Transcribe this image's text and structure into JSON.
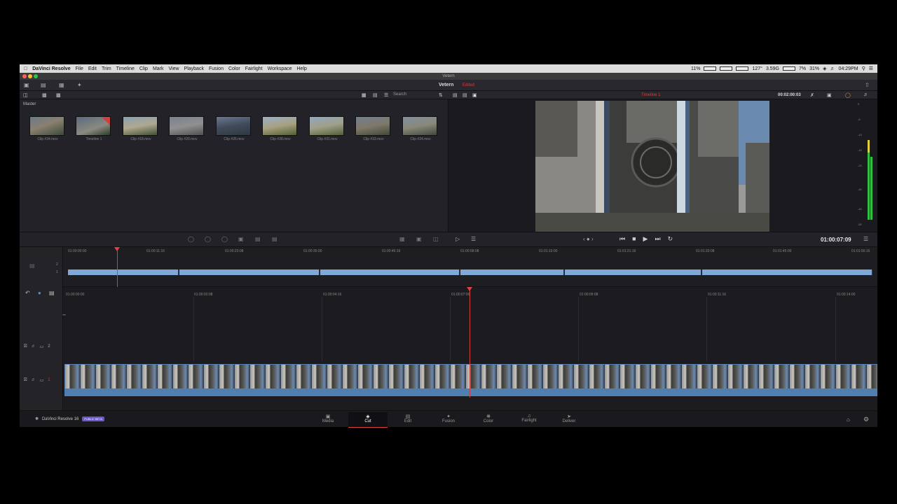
{
  "menubar": {
    "app": "DaVinci Resolve",
    "items": [
      "File",
      "Edit",
      "Trim",
      "Timeline",
      "Clip",
      "Mark",
      "View",
      "Playback",
      "Fusion",
      "Color",
      "Fairlight",
      "Workspace",
      "Help"
    ],
    "status": {
      "cpu": "11%",
      "temp": "127°",
      "mem": "3.59G",
      "net": "7%",
      "battery": "31%",
      "time": "04:29PM"
    }
  },
  "window": {
    "title": "Vetern"
  },
  "topbar": {
    "project_name": "Vetern",
    "project_status": "Edited"
  },
  "mediapool": {
    "search_label": "Search",
    "bin_label": "Master",
    "clips": [
      {
        "name": "Clip #34.mov"
      },
      {
        "name": "Timeline 1"
      },
      {
        "name": "Clip #18.mov"
      },
      {
        "name": "Clip #20.mov"
      },
      {
        "name": "Clip #26.mov"
      },
      {
        "name": "Clip #28.mov"
      },
      {
        "name": "Clip #31.mov"
      },
      {
        "name": "Clip #33.mov"
      },
      {
        "name": "Clip #24.mov"
      }
    ]
  },
  "viewer": {
    "timeline_name": "Timeline 1",
    "duration": "00:02:00:03",
    "timecode": "01:00:07:09",
    "meter_labels": [
      "0",
      "-5",
      "-10",
      "-15",
      "-20",
      "-30",
      "-40",
      "-50"
    ]
  },
  "overview_ruler": [
    "01:00:00:00",
    "01:00:11:16",
    "01:00:23:08",
    "01:00:35:00",
    "01:00:46:16",
    "01:00:58:08",
    "01:01:10:00",
    "01:01:21:16",
    "01:01:33:08",
    "01:01:45:00",
    "01:01:56:16"
  ],
  "timeline_ruler": [
    "01:00:00:00",
    "01:00:02:08",
    "01:00:04:16",
    "01:00:07:00",
    "01:00:09:08",
    "01:00:11:16",
    "01:00:14:00"
  ],
  "tracks": {
    "v2": "2",
    "v1": "1",
    "ov_v2": "2",
    "ov_v1": "1"
  },
  "brand": {
    "name": "DaVinci Resolve 16",
    "badge": "PUBLIC BETA"
  },
  "pages": [
    "Media",
    "Cut",
    "Edit",
    "Fusion",
    "Color",
    "Fairlight",
    "Deliver"
  ],
  "colors": {
    "accent": "#d04040",
    "clip_blue": "#7fa8d6",
    "badge": "#6858c8"
  }
}
